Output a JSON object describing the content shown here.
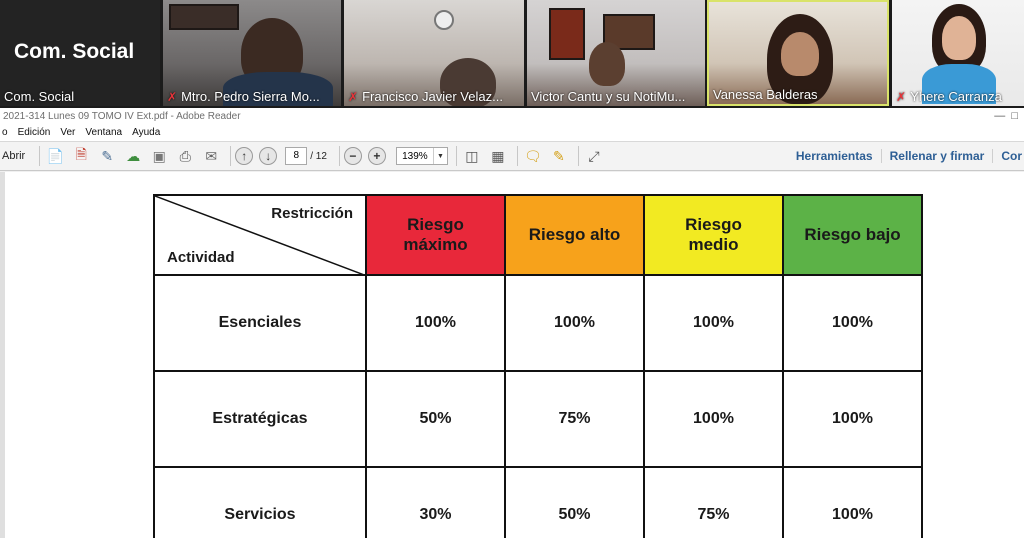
{
  "call": {
    "tiles": [
      {
        "big_label": "Com. Social",
        "name": "Com. Social",
        "muted": false
      },
      {
        "name": "Mtro. Pedro Sierra Mo...",
        "muted": true
      },
      {
        "name": "Francisco Javier Velaz...",
        "muted": true
      },
      {
        "name": "Victor Cantu y su NotiMu...",
        "muted": false
      },
      {
        "name": "Vanessa Balderas",
        "muted": false,
        "active": true
      },
      {
        "name": "Yhere Carranza",
        "muted": true
      }
    ],
    "mic_off_glyph": "✗"
  },
  "reader": {
    "title": "2021-314 Lunes 09 TOMO IV Ext.pdf - Adobe Reader",
    "menu": [
      "o",
      "Edición",
      "Ver",
      "Ventana",
      "Ayuda"
    ],
    "toolbar": {
      "open_label": "Abrir",
      "page_current": "8",
      "page_total": "/ 12",
      "zoom": "139%",
      "zoom_out": "−",
      "zoom_in": "+",
      "right_links": [
        "Herramientas",
        "Rellenar y firmar",
        "Cor"
      ]
    }
  },
  "table": {
    "header_restriction": "Restricción",
    "header_activity": "Actividad",
    "columns": [
      {
        "label_lines": [
          "Riesgo",
          "máximo"
        ],
        "color": "#e8283a"
      },
      {
        "label_lines": [
          "Riesgo alto"
        ],
        "color": "#f7a21b"
      },
      {
        "label_lines": [
          "Riesgo",
          "medio"
        ],
        "color": "#f2ea22"
      },
      {
        "label_lines": [
          "Riesgo bajo"
        ],
        "color": "#5cb247"
      }
    ],
    "rows": [
      {
        "label": "Esenciales",
        "values": [
          "100%",
          "100%",
          "100%",
          "100%"
        ]
      },
      {
        "label": "Estratégicas",
        "values": [
          "50%",
          "75%",
          "100%",
          "100%"
        ]
      },
      {
        "label": "Servicios",
        "values": [
          "30%",
          "50%",
          "75%",
          "100%"
        ]
      }
    ]
  }
}
